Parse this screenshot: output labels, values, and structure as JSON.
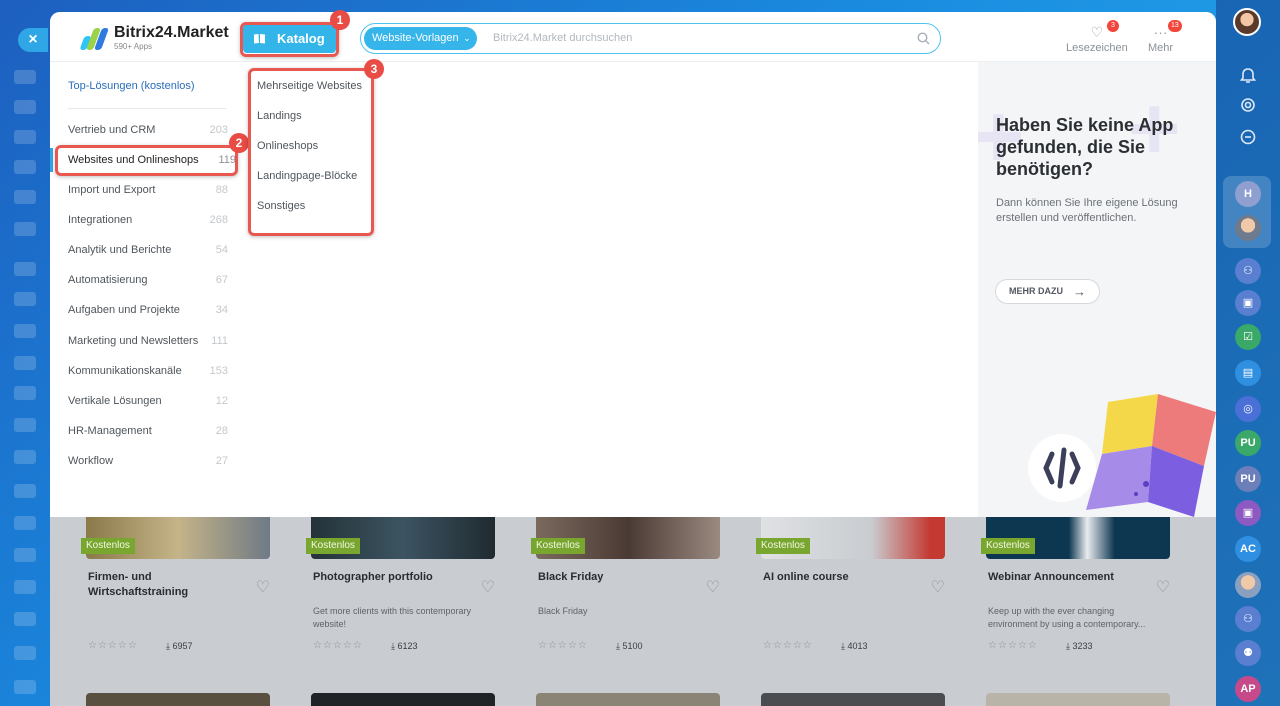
{
  "window": {
    "close_glyph": "×"
  },
  "brand": {
    "name": "Bitrix24.Market",
    "subtitle": "590+ Apps"
  },
  "header": {
    "catalog_label": "Katalog",
    "search": {
      "scope": "Website-Vorlagen",
      "placeholder": "Bitrix24.Market durchsuchen"
    },
    "bookmarks": {
      "label": "Lesezeichen",
      "count": "3"
    },
    "more": {
      "label": "Mehr",
      "count": "13"
    }
  },
  "callouts": [
    "1",
    "2",
    "3"
  ],
  "categories": {
    "top_label": "Top-Lösungen (kostenlos)",
    "items": [
      {
        "label": "Vertrieb und CRM",
        "count": "203"
      },
      {
        "label": "Websites und Onlineshops",
        "count": "119"
      },
      {
        "label": "Import und Export",
        "count": "88"
      },
      {
        "label": "Integrationen",
        "count": "268"
      },
      {
        "label": "Analytik und Berichte",
        "count": "54"
      },
      {
        "label": "Automatisierung",
        "count": "67"
      },
      {
        "label": "Aufgaben und Projekte",
        "count": "34"
      },
      {
        "label": "Marketing und Newsletters",
        "count": "111"
      },
      {
        "label": "Kommunikationskanäle",
        "count": "153"
      },
      {
        "label": "Vertikale Lösungen",
        "count": "12"
      },
      {
        "label": "HR-Management",
        "count": "28"
      },
      {
        "label": "Workflow",
        "count": "27"
      }
    ]
  },
  "subcategories": [
    "Mehrseitige Websites",
    "Landings",
    "Onlineshops",
    "Landingpage-Blöcke",
    "Sonstiges"
  ],
  "promo": {
    "title": "Haben Sie keine App gefunden, die Sie benötigen?",
    "text": "Dann können Sie Ihre eigene Lösung erstellen und veröffentlichen.",
    "button": "MEHR DAZU",
    "arrow": "→"
  },
  "cards": [
    {
      "badge": "Kostenlos",
      "title": "Firmen- und Wirtschaftstraining",
      "desc": "",
      "stars": "☆☆☆☆☆",
      "downloads": "6957"
    },
    {
      "badge": "Kostenlos",
      "title": "Photographer portfolio",
      "desc": "Get more clients with this contemporary website!",
      "stars": "☆☆☆☆☆",
      "downloads": "6123"
    },
    {
      "badge": "Kostenlos",
      "title": "Black Friday",
      "desc": "Black Friday",
      "stars": "☆☆☆☆☆",
      "downloads": "5100"
    },
    {
      "badge": "Kostenlos",
      "title": "AI online course",
      "desc": "",
      "stars": "☆☆☆☆☆",
      "downloads": "4013"
    },
    {
      "badge": "Kostenlos",
      "title": "Webinar Announcement",
      "desc": "Keep up with the ever changing environment by using a contemporary...",
      "stars": "☆☆☆☆☆",
      "downloads": "3233"
    }
  ],
  "right_rail": {
    "initials": [
      "H",
      "PU",
      "PU",
      "AC",
      "AP"
    ]
  },
  "colors": {
    "accent": "#34b5ea",
    "highlight": "#e85750",
    "free_badge": "#78a62f"
  }
}
